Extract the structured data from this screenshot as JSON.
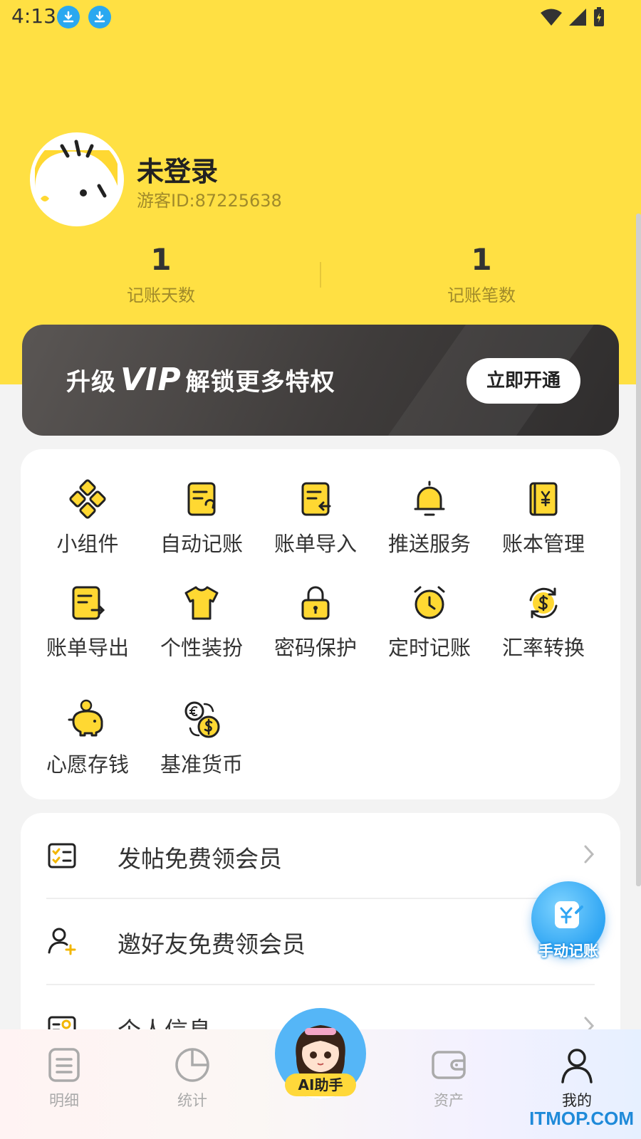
{
  "status_bar": {
    "time": "4:13"
  },
  "profile": {
    "name": "未登录",
    "guest_id": "游客ID:87225638",
    "stats": [
      {
        "value": "1",
        "label": "记账天数"
      },
      {
        "value": "1",
        "label": "记账笔数"
      }
    ]
  },
  "vip_banner": {
    "prefix": "升级",
    "vip": "VIP",
    "suffix": "解锁更多特权",
    "button": "立即开通"
  },
  "features": [
    {
      "label": "小组件",
      "icon": "widget-icon"
    },
    {
      "label": "自动记账",
      "icon": "auto-bookkeeping-icon"
    },
    {
      "label": "账单导入",
      "icon": "bill-import-icon"
    },
    {
      "label": "推送服务",
      "icon": "bell-icon"
    },
    {
      "label": "账本管理",
      "icon": "ledger-icon"
    },
    {
      "label": "账单导出",
      "icon": "bill-export-icon"
    },
    {
      "label": "个性装扮",
      "icon": "tshirt-icon"
    },
    {
      "label": "密码保护",
      "icon": "lock-icon"
    },
    {
      "label": "定时记账",
      "icon": "alarm-clock-icon"
    },
    {
      "label": "汇率转换",
      "icon": "exchange-rate-icon"
    },
    {
      "label": "心愿存钱",
      "icon": "piggy-bank-icon"
    },
    {
      "label": "基准货币",
      "icon": "currency-icon"
    }
  ],
  "list": [
    {
      "label": "发帖免费领会员",
      "icon": "checklist-icon"
    },
    {
      "label": "邀好友免费领会员",
      "icon": "add-user-icon"
    },
    {
      "label": "个人信息",
      "icon": "profile-card-icon"
    }
  ],
  "fab": {
    "label": "手动记账"
  },
  "bottom_nav": {
    "items": [
      {
        "label": "明细"
      },
      {
        "label": "统计"
      },
      {
        "label": "资产"
      },
      {
        "label": "我的"
      }
    ],
    "ai_label": "AI助手"
  },
  "watermark": "ITMOP.COM",
  "colors": {
    "accent_yellow": "#FFE043",
    "fab_blue": "#2FA5F3"
  }
}
